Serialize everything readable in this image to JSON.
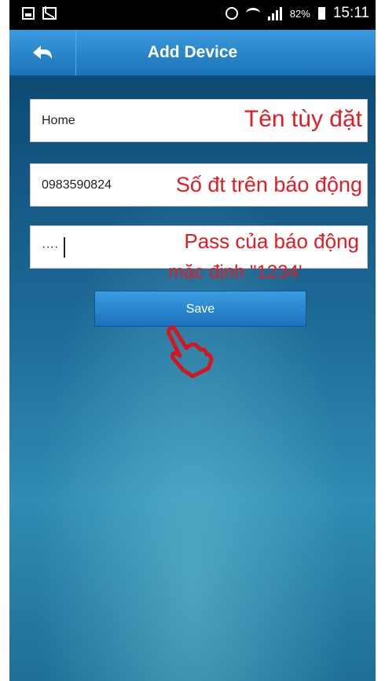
{
  "status_bar": {
    "battery": "82%",
    "time": "15:11"
  },
  "toolbar": {
    "title": "Add Device",
    "back_icon": "back-arrow-icon"
  },
  "form": {
    "name_value": "Home",
    "name_note": "Tên tùy đặt",
    "phone_value": "0983590824",
    "phone_note": "Số đt trên báo động",
    "password_value": "····",
    "password_note": "Pass của báo động",
    "password_note2": "mặc định \"1234'",
    "save_label": "Save"
  },
  "colors": {
    "accent": "#1a73b8",
    "annotation": "#e41b23"
  }
}
